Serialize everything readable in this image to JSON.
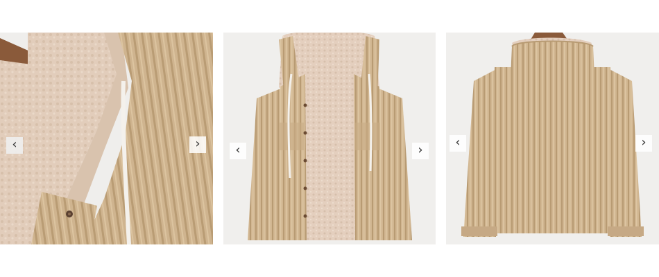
{
  "gallery": {
    "items": [
      {
        "label": "corduroy-hooded-jacket-detail-closeup"
      },
      {
        "label": "corduroy-hooded-jacket-front-open"
      },
      {
        "label": "corduroy-hooded-jacket-back"
      }
    ],
    "controls": {
      "prev_glyph": "‹",
      "next_glyph": "›",
      "prev_icon": "chevron-left-icon",
      "next_icon": "chevron-right-icon"
    }
  },
  "colors": {
    "page_bg": "#ffffff",
    "card_bg": "#f1f0ee",
    "corduroy": "#cfb48f",
    "corduroy_dark": "#b99c74",
    "fleece": "#e2cdbb",
    "fleece_dark": "#d1b8a3",
    "hanger": "#8a5a3a",
    "drawstring": "#f4f1ec"
  }
}
